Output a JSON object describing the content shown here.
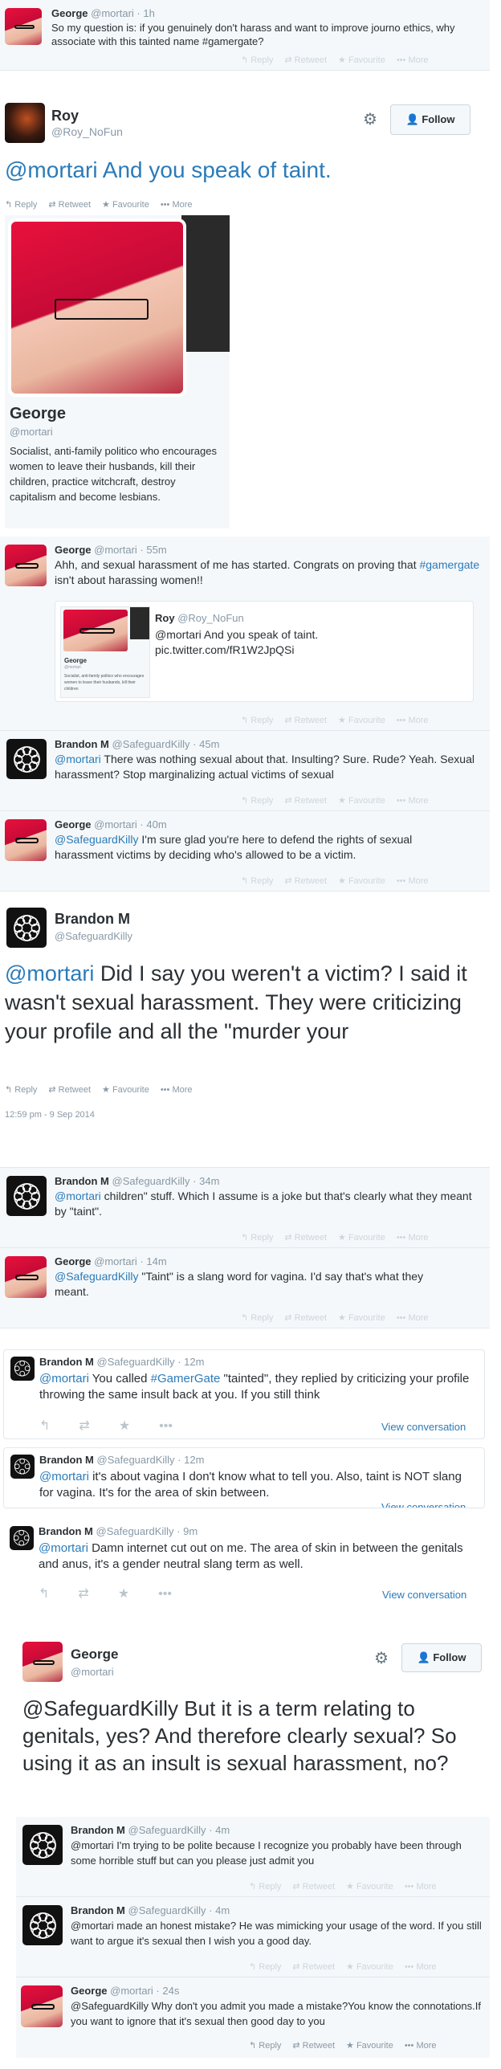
{
  "t1": {
    "name": "George",
    "handle": "@mortari",
    "time": "· 1h",
    "text": "So my question is: if you genuinely don't harass and want to improve journo ethics, why associate with this tainted name #gamergate?"
  },
  "actions": {
    "reply": "↰ Reply",
    "retweet": "⇄ Retweet",
    "favourite": "★ Favourite",
    "more": "••• More"
  },
  "roy": {
    "name": "Roy",
    "handle": "@Roy_NoFun",
    "follow": "Follow",
    "text": "@mortari And you speak of taint."
  },
  "profile": {
    "name": "George",
    "handle": "@mortari",
    "bio": "Socialist, anti-family politico who encourages women to leave their husbands, kill their children, practice witchcraft, destroy capitalism and become lesbians."
  },
  "r1": {
    "name": "George",
    "handle": "@mortari",
    "time": "· 55m",
    "text_a": "Ahh, and sexual harassment of me has started. Congrats on proving that ",
    "tag": "#gamergate",
    "text_b": " isn't about harassing women!!"
  },
  "quote": {
    "name": "Roy",
    "handle": "@Roy_NoFun",
    "text": "@mortari And you speak of taint.",
    "link": "pic.twitter.com/fR1W2JpQSi",
    "mini_name": "George",
    "mini_handle": "@mortari",
    "mini_bio": "Socialist, anti-family politico who encourages women to leave their husbands, kill their children"
  },
  "r2": {
    "name": "Brandon M",
    "handle": "@SafeguardKilly",
    "time": "· 45m",
    "mention": "@mortari",
    "text": " There was nothing sexual about that. Insulting? Sure. Rude? Yeah. Sexual harassment? Stop marginalizing actual victims of sexual"
  },
  "r3": {
    "name": "George",
    "handle": "@mortari",
    "time": "· 40m",
    "mention": "@SafeguardKilly",
    "text": " I'm sure glad you're here to defend the rights of sexual harassment victims by deciding who's allowed to be a victim."
  },
  "b1": {
    "name": "Brandon M",
    "handle": "@SafeguardKilly",
    "mention": "@mortari",
    "text": " Did I say you weren't a victim? I said it wasn't sexual harassment. They were criticizing your profile and all the \"murder your",
    "date": "12:59 pm - 9 Sep 2014"
  },
  "r4": {
    "name": "Brandon M",
    "handle": "@SafeguardKilly",
    "time": "· 34m",
    "mention": "@mortari",
    "text": " children\" stuff. Which I assume is a joke but that's clearly what they meant by \"taint\"."
  },
  "r5": {
    "name": "George",
    "handle": "@mortari",
    "time": "· 14m",
    "mention": "@SafeguardKilly",
    "text": " \"Taint\" is a slang word for vagina. I'd say that's what they meant."
  },
  "r6": {
    "name": "Brandon M",
    "handle": "@SafeguardKilly",
    "time": "· 12m",
    "mention": "@mortari",
    "text_a": " You called ",
    "tag": "#GamerGate",
    "text_b": " \"tainted\", they replied by criticizing your profile throwing the same insult back at you. If you still think",
    "view": "View conversation"
  },
  "r7": {
    "name": "Brandon M",
    "handle": "@SafeguardKilly",
    "time": "· 12m",
    "mention": "@mortari",
    "text": " it's about vagina I don't know what to tell you. Also, taint is NOT slang for vagina. It's for the area of skin between.",
    "view": "View conversation"
  },
  "r8": {
    "name": "Brandon M",
    "handle": "@SafeguardKilly",
    "time": "· 9m",
    "mention": "@mortari",
    "text": " Damn internet cut out on me. The area of skin in between the genitals and anus, it's a gender neutral slang term as well.",
    "view": "View conversation"
  },
  "g2": {
    "name": "George",
    "handle": "@mortari",
    "follow": "Follow",
    "text": "@SafeguardKilly But it is a term relating to genitals, yes? And therefore clearly sexual? So using it as an insult is sexual harassment, no?"
  },
  "r9": {
    "name": "Brandon M",
    "handle": "@SafeguardKilly",
    "time": "· 4m",
    "text": "@mortari I'm trying to be polite because I recognize you probably have been through some horrible stuff but can you please just admit you"
  },
  "r10": {
    "name": "Brandon M",
    "handle": "@SafeguardKilly",
    "time": "· 4m",
    "text": "@mortari made an honest mistake? He was mimicking your usage of the word. If you still want to argue it's sexual then I wish you a good day."
  },
  "r11": {
    "name": "George",
    "handle": "@mortari",
    "time": "· 24s",
    "text": "@SafeguardKilly Why don't you admit you made a mistake?You know the connotations.If you want to ignore that it's sexual then good day to you"
  }
}
